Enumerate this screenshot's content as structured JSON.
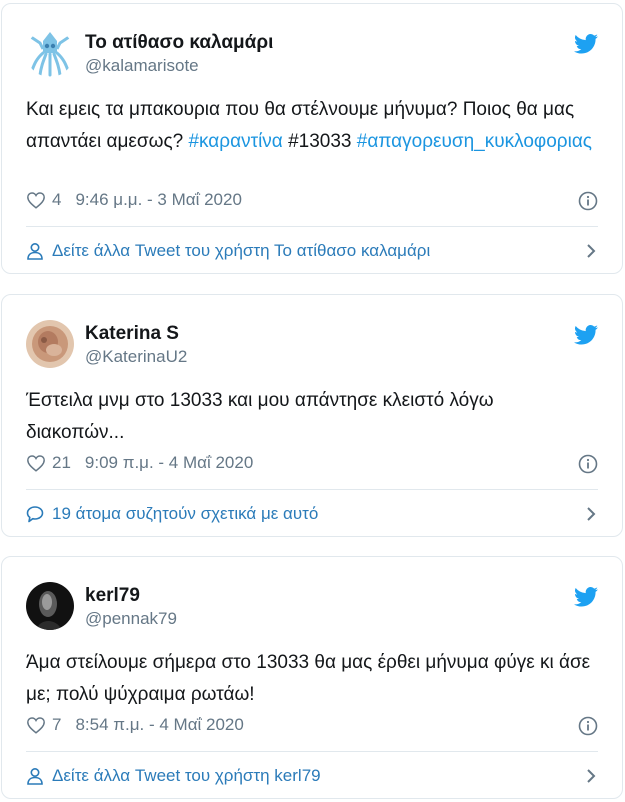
{
  "colors": {
    "link": "#1b95e0",
    "footer_link": "#2b7bb9",
    "muted": "#657786",
    "text": "#14171a",
    "border": "#e1e8ed"
  },
  "tweets": [
    {
      "name": "Το ατίθασο καλαμάρι",
      "handle": "@kalamarisote",
      "text_1": "Και εμεις τα μπακουρια που θα στέλνουμε μήνυμα? Ποιος θα μας απαντάει αμεσως? ",
      "hashtag_1": "#καραντίνα",
      "text_2": " #13033 ",
      "hashtag_2": "#απαγορευση_κυκλοφοριας",
      "likes": "4",
      "timestamp": "9:46 μ.μ. - 3 Μαΐ 2020",
      "footer": "Δείτε άλλα Tweet του χρήστη Το ατίθασο καλαμάρι",
      "avatar_icon": "squid-avatar",
      "footer_icon": "person-icon"
    },
    {
      "name": "Katerina S",
      "handle": "@KaterinaU2",
      "text": "Έστειλα μνμ στο 13033 και μου απάντησε κλειστό λόγω διακοπών...",
      "likes": "21",
      "timestamp": "9:09 π.μ. - 4 Μαΐ 2020",
      "footer": "19 άτομα συζητούν σχετικά με αυτό",
      "avatar_icon": "photo-avatar",
      "footer_icon": "speech-bubble-icon"
    },
    {
      "name": "kerl79",
      "handle": "@pennak79",
      "text": "Άμα στείλουμε σήμερα στο 13033 θα μας έρθει μήνυμα φύγε κι άσε με; πολύ ψύχραιμα ρωτάω!",
      "likes": "7",
      "timestamp": "8:54 π.μ. - 4 Μαΐ 2020",
      "footer": "Δείτε άλλα Tweet του χρήστη kerl79",
      "avatar_icon": "dark-photo-avatar",
      "footer_icon": "person-icon"
    }
  ]
}
